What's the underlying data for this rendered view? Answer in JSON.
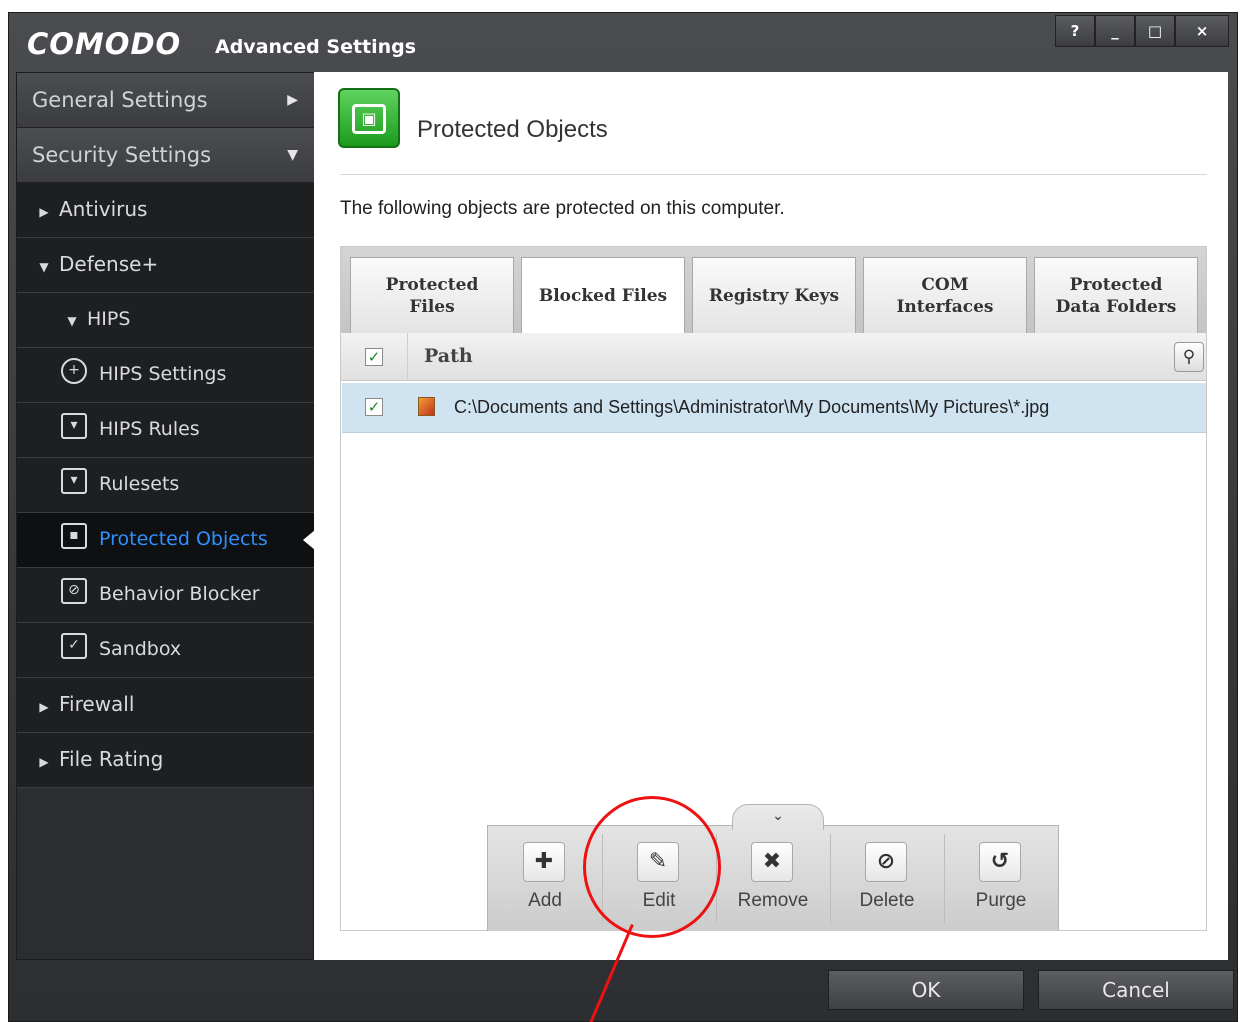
{
  "window": {
    "logo": "COMODO",
    "title": "Advanced Settings",
    "buttons": {
      "help": "?",
      "minimize": "_",
      "maximize": "□",
      "close": "×"
    }
  },
  "sidebar": {
    "general_settings": "General Settings",
    "security_settings": "Security Settings",
    "antivirus": "Antivirus",
    "defense_plus": "Defense+",
    "hips": "HIPS",
    "hips_settings": "HIPS Settings",
    "hips_rules": "HIPS Rules",
    "rulesets": "Rulesets",
    "protected_objects": "Protected Objects",
    "behavior_blocker": "Behavior Blocker",
    "sandbox": "Sandbox",
    "firewall": "Firewall",
    "file_rating": "File Rating"
  },
  "main": {
    "title": "Protected Objects",
    "description": "The following objects are protected on this computer.",
    "tabs": [
      {
        "label": "Protected Files"
      },
      {
        "label": "Blocked Files"
      },
      {
        "label": "Registry Keys"
      },
      {
        "label": "COM Interfaces"
      },
      {
        "label": "Protected Data Folders"
      }
    ],
    "active_tab": "Blocked Files",
    "column_path": "Path",
    "rows": [
      {
        "path": "C:\\Documents and Settings\\Administrator\\My Documents\\My Pictures\\*.jpg",
        "checked": true
      }
    ]
  },
  "toolbar": {
    "add": "Add",
    "edit": "Edit",
    "remove": "Remove",
    "delete": "Delete",
    "purge": "Purge"
  },
  "footer": {
    "ok": "OK",
    "cancel": "Cancel"
  },
  "colors": {
    "accent_selected": "#2f8fff",
    "annotation": "#ee1111",
    "row_highlight": "#cfe3f1"
  }
}
